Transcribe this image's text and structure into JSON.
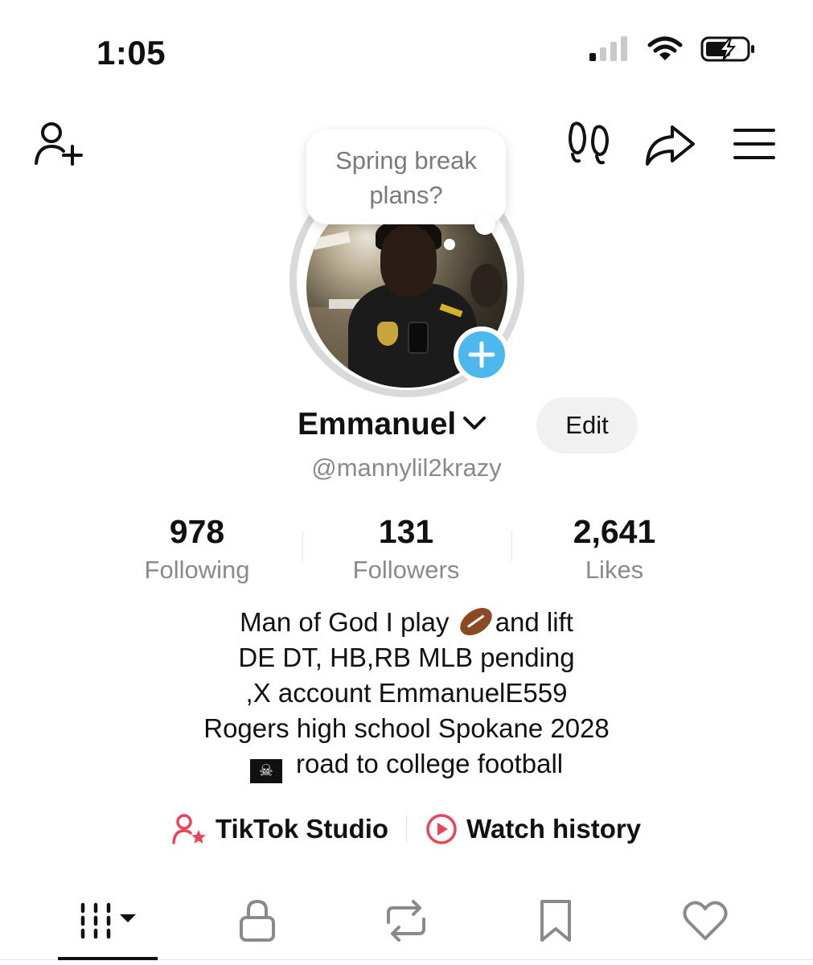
{
  "status_bar": {
    "time": "1:05",
    "icons": [
      "signal-icon",
      "wifi-icon",
      "battery-charging-icon"
    ]
  },
  "top_nav": {
    "left_icon": "add-friend-icon",
    "right_icons": [
      "footprints-icon",
      "share-icon",
      "menu-icon"
    ]
  },
  "note_bubble": {
    "text_line1": "Spring break",
    "text_line2": "plans?"
  },
  "profile": {
    "display_name": "Emmanuel",
    "edit_label": "Edit",
    "username": "@mannylil2krazy",
    "add_icon": "plus-icon"
  },
  "stats": [
    {
      "value": "978",
      "label": "Following"
    },
    {
      "value": "131",
      "label": "Followers"
    },
    {
      "value": "2,641",
      "label": "Likes"
    }
  ],
  "bio": {
    "line1_before": "Man of God I play ",
    "line1_after": "and lift",
    "line2": "DE DT, HB,RB  MLB pending",
    "line3": ",X account EmmanuelE559",
    "line4": "Rogers high school Spokane 2028",
    "line5": " road to college football"
  },
  "links": {
    "studio_label": "TikTok Studio",
    "history_label": "Watch history",
    "accent_color": "#e8455c"
  },
  "tabs": [
    "grid-icon",
    "lock-icon",
    "repost-icon",
    "bookmark-icon",
    "heart-icon"
  ],
  "colors": {
    "add_button": "#4cb8ee",
    "secondary_text": "#8a8a8a"
  }
}
